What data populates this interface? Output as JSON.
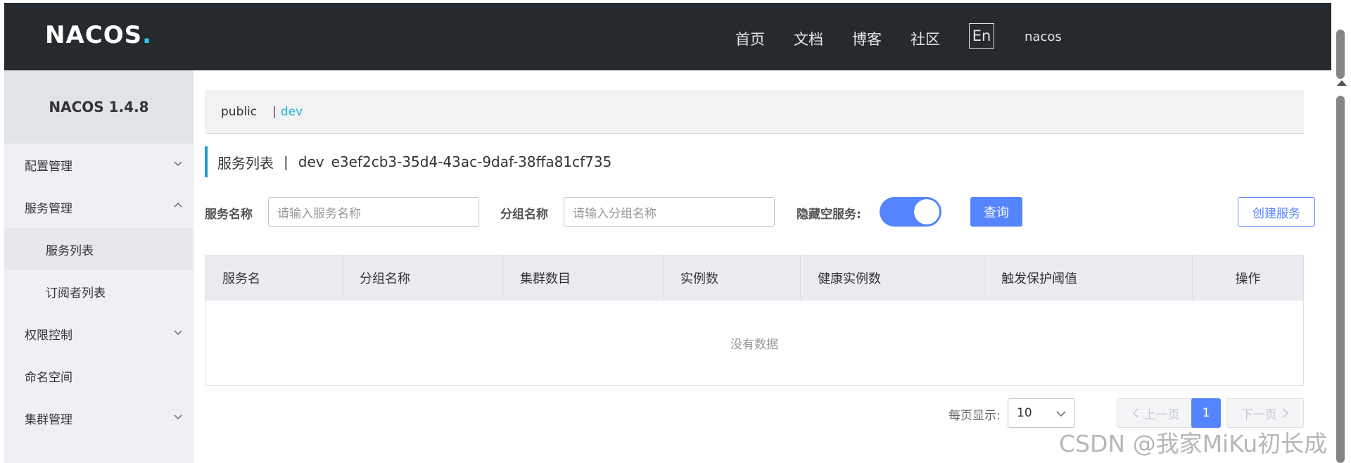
{
  "header": {
    "logo": "NACOS.",
    "nav": [
      "首页",
      "文档",
      "博客",
      "社区"
    ],
    "lang": "En",
    "user": "nacos"
  },
  "sidebar": {
    "title": "NACOS 1.4.8",
    "items": [
      {
        "label": "配置管理",
        "chevron": "down"
      },
      {
        "label": "服务管理",
        "chevron": "up"
      },
      {
        "label": "服务列表",
        "sub": true,
        "active": true
      },
      {
        "label": "订阅者列表",
        "sub": true
      },
      {
        "label": "权限控制",
        "chevron": "down"
      },
      {
        "label": "命名空间"
      },
      {
        "label": "集群管理",
        "chevron": "down"
      }
    ]
  },
  "namespace": {
    "public": "public",
    "separator": "|",
    "active": "dev"
  },
  "page_title": {
    "title": "服务列表",
    "separator": "|",
    "ns_name": "dev",
    "ns_id": "e3ef2cb3-35d4-43ac-9daf-38ffa81cf735"
  },
  "search": {
    "service_name_label": "服务名称",
    "service_name_placeholder": "请输入服务名称",
    "group_name_label": "分组名称",
    "group_name_placeholder": "请输入分组名称",
    "hide_empty_label": "隐藏空服务:",
    "hide_empty_on": true,
    "query_button": "查询",
    "create_button": "创建服务"
  },
  "table": {
    "columns": [
      "服务名",
      "分组名称",
      "集群数目",
      "实例数",
      "健康实例数",
      "触发保护阈值",
      "操作"
    ],
    "rows": [],
    "empty_text": "没有数据"
  },
  "pagination": {
    "page_size_label": "每页显示:",
    "page_size": "10",
    "prev": "上一页",
    "next": "下一页",
    "current_page": "1"
  },
  "watermark": "CSDN @我家MiKu初长成",
  "colors": {
    "header_bg": "#252a2f",
    "primary": "#5584ff",
    "accent": "#1f9ad6"
  }
}
